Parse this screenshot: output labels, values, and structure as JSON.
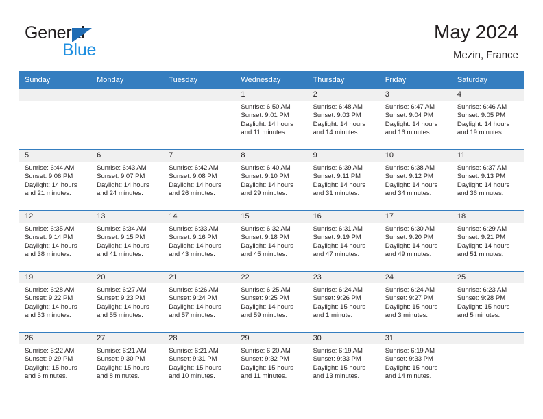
{
  "logo": {
    "word_top": "General",
    "word_bottom": "Blue",
    "triangle_color": "#1f6cb4",
    "blue_text_color": "#1f8fe0"
  },
  "header": {
    "title": "May 2024",
    "location": "Mezin, France",
    "header_bg": "#357ec0",
    "daynum_bg": "#f0f0f0"
  },
  "weekdays": [
    "Sunday",
    "Monday",
    "Tuesday",
    "Wednesday",
    "Thursday",
    "Friday",
    "Saturday"
  ],
  "labels": {
    "sunrise": "Sunrise:",
    "sunset": "Sunset:",
    "daylight": "Daylight:"
  },
  "weeks": [
    [
      {
        "day": "",
        "sunrise": "",
        "sunset": "",
        "daylight_line1": "",
        "daylight_line2": ""
      },
      {
        "day": "",
        "sunrise": "",
        "sunset": "",
        "daylight_line1": "",
        "daylight_line2": ""
      },
      {
        "day": "",
        "sunrise": "",
        "sunset": "",
        "daylight_line1": "",
        "daylight_line2": ""
      },
      {
        "day": "1",
        "sunrise": "Sunrise: 6:50 AM",
        "sunset": "Sunset: 9:01 PM",
        "daylight_line1": "Daylight: 14 hours",
        "daylight_line2": "and 11 minutes."
      },
      {
        "day": "2",
        "sunrise": "Sunrise: 6:48 AM",
        "sunset": "Sunset: 9:03 PM",
        "daylight_line1": "Daylight: 14 hours",
        "daylight_line2": "and 14 minutes."
      },
      {
        "day": "3",
        "sunrise": "Sunrise: 6:47 AM",
        "sunset": "Sunset: 9:04 PM",
        "daylight_line1": "Daylight: 14 hours",
        "daylight_line2": "and 16 minutes."
      },
      {
        "day": "4",
        "sunrise": "Sunrise: 6:46 AM",
        "sunset": "Sunset: 9:05 PM",
        "daylight_line1": "Daylight: 14 hours",
        "daylight_line2": "and 19 minutes."
      }
    ],
    [
      {
        "day": "5",
        "sunrise": "Sunrise: 6:44 AM",
        "sunset": "Sunset: 9:06 PM",
        "daylight_line1": "Daylight: 14 hours",
        "daylight_line2": "and 21 minutes."
      },
      {
        "day": "6",
        "sunrise": "Sunrise: 6:43 AM",
        "sunset": "Sunset: 9:07 PM",
        "daylight_line1": "Daylight: 14 hours",
        "daylight_line2": "and 24 minutes."
      },
      {
        "day": "7",
        "sunrise": "Sunrise: 6:42 AM",
        "sunset": "Sunset: 9:08 PM",
        "daylight_line1": "Daylight: 14 hours",
        "daylight_line2": "and 26 minutes."
      },
      {
        "day": "8",
        "sunrise": "Sunrise: 6:40 AM",
        "sunset": "Sunset: 9:10 PM",
        "daylight_line1": "Daylight: 14 hours",
        "daylight_line2": "and 29 minutes."
      },
      {
        "day": "9",
        "sunrise": "Sunrise: 6:39 AM",
        "sunset": "Sunset: 9:11 PM",
        "daylight_line1": "Daylight: 14 hours",
        "daylight_line2": "and 31 minutes."
      },
      {
        "day": "10",
        "sunrise": "Sunrise: 6:38 AM",
        "sunset": "Sunset: 9:12 PM",
        "daylight_line1": "Daylight: 14 hours",
        "daylight_line2": "and 34 minutes."
      },
      {
        "day": "11",
        "sunrise": "Sunrise: 6:37 AM",
        "sunset": "Sunset: 9:13 PM",
        "daylight_line1": "Daylight: 14 hours",
        "daylight_line2": "and 36 minutes."
      }
    ],
    [
      {
        "day": "12",
        "sunrise": "Sunrise: 6:35 AM",
        "sunset": "Sunset: 9:14 PM",
        "daylight_line1": "Daylight: 14 hours",
        "daylight_line2": "and 38 minutes."
      },
      {
        "day": "13",
        "sunrise": "Sunrise: 6:34 AM",
        "sunset": "Sunset: 9:15 PM",
        "daylight_line1": "Daylight: 14 hours",
        "daylight_line2": "and 41 minutes."
      },
      {
        "day": "14",
        "sunrise": "Sunrise: 6:33 AM",
        "sunset": "Sunset: 9:16 PM",
        "daylight_line1": "Daylight: 14 hours",
        "daylight_line2": "and 43 minutes."
      },
      {
        "day": "15",
        "sunrise": "Sunrise: 6:32 AM",
        "sunset": "Sunset: 9:18 PM",
        "daylight_line1": "Daylight: 14 hours",
        "daylight_line2": "and 45 minutes."
      },
      {
        "day": "16",
        "sunrise": "Sunrise: 6:31 AM",
        "sunset": "Sunset: 9:19 PM",
        "daylight_line1": "Daylight: 14 hours",
        "daylight_line2": "and 47 minutes."
      },
      {
        "day": "17",
        "sunrise": "Sunrise: 6:30 AM",
        "sunset": "Sunset: 9:20 PM",
        "daylight_line1": "Daylight: 14 hours",
        "daylight_line2": "and 49 minutes."
      },
      {
        "day": "18",
        "sunrise": "Sunrise: 6:29 AM",
        "sunset": "Sunset: 9:21 PM",
        "daylight_line1": "Daylight: 14 hours",
        "daylight_line2": "and 51 minutes."
      }
    ],
    [
      {
        "day": "19",
        "sunrise": "Sunrise: 6:28 AM",
        "sunset": "Sunset: 9:22 PM",
        "daylight_line1": "Daylight: 14 hours",
        "daylight_line2": "and 53 minutes."
      },
      {
        "day": "20",
        "sunrise": "Sunrise: 6:27 AM",
        "sunset": "Sunset: 9:23 PM",
        "daylight_line1": "Daylight: 14 hours",
        "daylight_line2": "and 55 minutes."
      },
      {
        "day": "21",
        "sunrise": "Sunrise: 6:26 AM",
        "sunset": "Sunset: 9:24 PM",
        "daylight_line1": "Daylight: 14 hours",
        "daylight_line2": "and 57 minutes."
      },
      {
        "day": "22",
        "sunrise": "Sunrise: 6:25 AM",
        "sunset": "Sunset: 9:25 PM",
        "daylight_line1": "Daylight: 14 hours",
        "daylight_line2": "and 59 minutes."
      },
      {
        "day": "23",
        "sunrise": "Sunrise: 6:24 AM",
        "sunset": "Sunset: 9:26 PM",
        "daylight_line1": "Daylight: 15 hours",
        "daylight_line2": "and 1 minute."
      },
      {
        "day": "24",
        "sunrise": "Sunrise: 6:24 AM",
        "sunset": "Sunset: 9:27 PM",
        "daylight_line1": "Daylight: 15 hours",
        "daylight_line2": "and 3 minutes."
      },
      {
        "day": "25",
        "sunrise": "Sunrise: 6:23 AM",
        "sunset": "Sunset: 9:28 PM",
        "daylight_line1": "Daylight: 15 hours",
        "daylight_line2": "and 5 minutes."
      }
    ],
    [
      {
        "day": "26",
        "sunrise": "Sunrise: 6:22 AM",
        "sunset": "Sunset: 9:29 PM",
        "daylight_line1": "Daylight: 15 hours",
        "daylight_line2": "and 6 minutes."
      },
      {
        "day": "27",
        "sunrise": "Sunrise: 6:21 AM",
        "sunset": "Sunset: 9:30 PM",
        "daylight_line1": "Daylight: 15 hours",
        "daylight_line2": "and 8 minutes."
      },
      {
        "day": "28",
        "sunrise": "Sunrise: 6:21 AM",
        "sunset": "Sunset: 9:31 PM",
        "daylight_line1": "Daylight: 15 hours",
        "daylight_line2": "and 10 minutes."
      },
      {
        "day": "29",
        "sunrise": "Sunrise: 6:20 AM",
        "sunset": "Sunset: 9:32 PM",
        "daylight_line1": "Daylight: 15 hours",
        "daylight_line2": "and 11 minutes."
      },
      {
        "day": "30",
        "sunrise": "Sunrise: 6:19 AM",
        "sunset": "Sunset: 9:33 PM",
        "daylight_line1": "Daylight: 15 hours",
        "daylight_line2": "and 13 minutes."
      },
      {
        "day": "31",
        "sunrise": "Sunrise: 6:19 AM",
        "sunset": "Sunset: 9:33 PM",
        "daylight_line1": "Daylight: 15 hours",
        "daylight_line2": "and 14 minutes."
      },
      {
        "day": "",
        "sunrise": "",
        "sunset": "",
        "daylight_line1": "",
        "daylight_line2": ""
      }
    ]
  ]
}
